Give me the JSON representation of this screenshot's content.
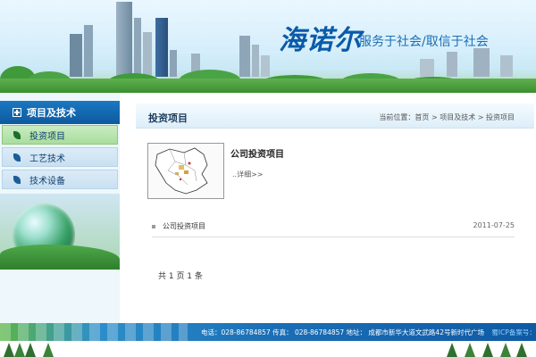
{
  "header": {
    "logo_text": "海诺尔",
    "slogan": "服务于社会/取信于社会"
  },
  "sidebar": {
    "heading": "项目及技术",
    "items": [
      {
        "label": "投资项目",
        "active": true
      },
      {
        "label": "工艺技术",
        "active": false
      },
      {
        "label": "技术设备",
        "active": false
      }
    ]
  },
  "main": {
    "section_title": "投资项目",
    "breadcrumb": "当前位置：首页 > 项目及技术 > 投资项目",
    "project": {
      "title": "公司投资项目",
      "more": "..详细>>"
    },
    "list": [
      {
        "title": "公司投资项目",
        "date": "2011-07-25"
      }
    ],
    "pager": "共 1 页 1 条"
  },
  "footer": {
    "contact": "电话：028-86784857  传真：   028-86784857  地址：   成都市新华大道文武路42号新时代广场",
    "link": "蜀ICP备案号：********"
  },
  "colors": {
    "brand_blue": "#0d5a9e",
    "active_green": "#a9dd9d"
  },
  "icons": [
    "plus-box-icon",
    "leaf-icon",
    "square-bullet-icon",
    "map-thumbnail"
  ]
}
